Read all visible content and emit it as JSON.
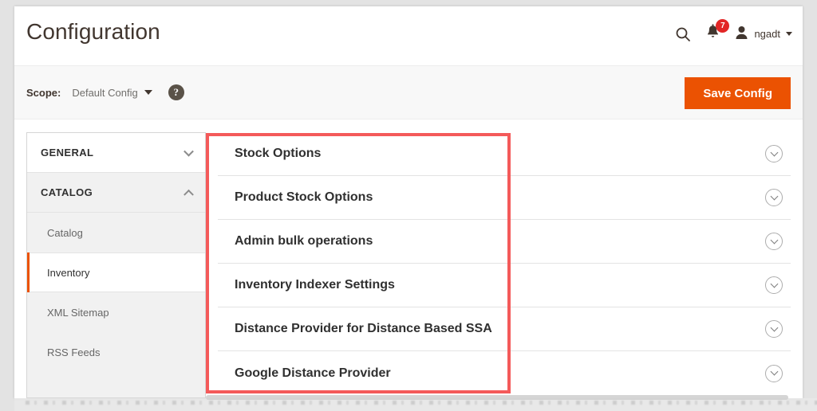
{
  "header": {
    "title": "Configuration",
    "search_icon": "search-icon",
    "notifications": {
      "icon": "bell-icon",
      "count": "7"
    },
    "user": {
      "avatar_icon": "user-avatar-icon",
      "name": "ngadt",
      "caret_icon": "caret-down-icon"
    }
  },
  "scope_bar": {
    "label": "Scope:",
    "value": "Default Config",
    "caret_icon": "caret-down-icon",
    "help_icon": "question-mark-icon",
    "help_glyph": "?",
    "save_label": "Save Config"
  },
  "sidebar": {
    "groups": [
      {
        "label": "GENERAL",
        "expanded": false,
        "chevron": "chevron-down-icon",
        "items": []
      },
      {
        "label": "CATALOG",
        "expanded": true,
        "chevron": "chevron-up-icon",
        "items": [
          {
            "label": "Catalog",
            "active": false
          },
          {
            "label": "Inventory",
            "active": true
          },
          {
            "label": "XML Sitemap",
            "active": false
          },
          {
            "label": "RSS Feeds",
            "active": false
          }
        ]
      }
    ]
  },
  "content": {
    "sections": [
      {
        "title": "Stock Options",
        "toggle_icon": "chevron-down-circle-icon",
        "expanded": false
      },
      {
        "title": "Product Stock Options",
        "toggle_icon": "chevron-down-circle-icon",
        "expanded": false
      },
      {
        "title": "Admin bulk operations",
        "toggle_icon": "chevron-down-circle-icon",
        "expanded": false
      },
      {
        "title": "Inventory Indexer Settings",
        "toggle_icon": "chevron-down-circle-icon",
        "expanded": false
      },
      {
        "title": "Distance Provider for Distance Based SSA",
        "toggle_icon": "chevron-down-circle-icon",
        "expanded": false
      },
      {
        "title": "Google Distance Provider",
        "toggle_icon": "chevron-down-circle-icon",
        "expanded": false
      }
    ]
  },
  "annotation": {
    "type": "highlight-rectangle",
    "color": "#f45a5a"
  },
  "colors": {
    "accent_orange": "#eb5202",
    "badge_red": "#e22626",
    "text_dark": "#303030",
    "title_gray": "#41362f",
    "panel_gray": "#f1f1f1",
    "scope_bar_bg": "#f8f8f8"
  }
}
